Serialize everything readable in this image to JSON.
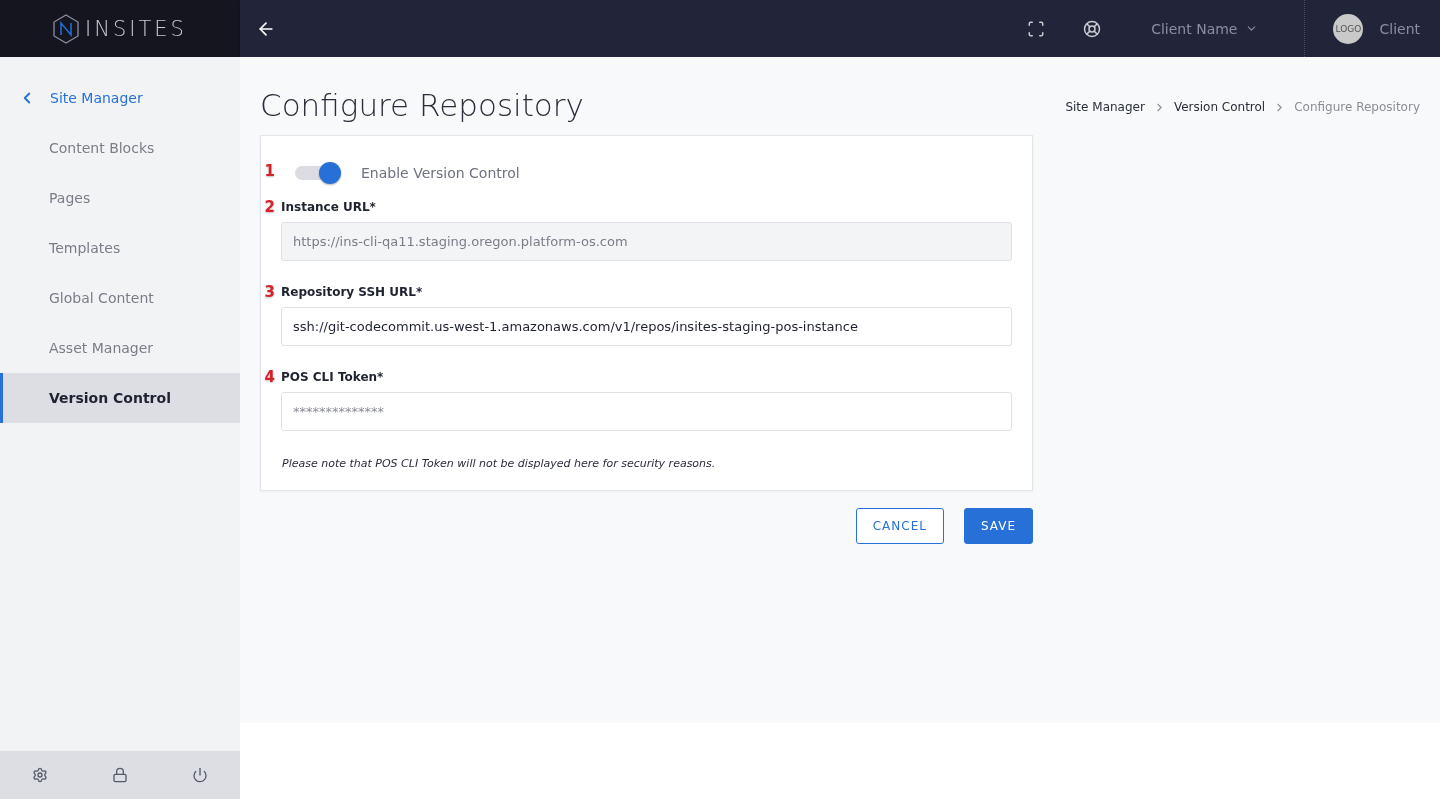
{
  "topbar": {
    "logo_text": "INSITES",
    "client_menu": "Client Name",
    "avatar_text": "LOGO",
    "account": "Client"
  },
  "sidebar": {
    "back_label": "Site Manager",
    "items": [
      {
        "label": "Content Blocks",
        "selected": false
      },
      {
        "label": "Pages",
        "selected": false
      },
      {
        "label": "Templates",
        "selected": false
      },
      {
        "label": "Global Content",
        "selected": false
      },
      {
        "label": "Asset Manager",
        "selected": false
      },
      {
        "label": "Version Control",
        "selected": true
      }
    ]
  },
  "page": {
    "title": "Configure Repository",
    "breadcrumbs": [
      {
        "label": "Site Manager",
        "current": false
      },
      {
        "label": "Version Control",
        "current": false
      },
      {
        "label": "Configure Repository",
        "current": true
      }
    ]
  },
  "form": {
    "toggle": {
      "marker": "1",
      "label": "Enable Version Control",
      "on": true
    },
    "fields": [
      {
        "marker": "2",
        "label": "Instance URL*",
        "value": "https://ins-cli-qa11.staging.oregon.platform-os.com",
        "disabled": true
      },
      {
        "marker": "3",
        "label": "Repository SSH URL*",
        "value": "ssh://git-codecommit.us-west-1.amazonaws.com/v1/repos/insites-staging-pos-instance",
        "disabled": false
      },
      {
        "marker": "4",
        "label": "POS CLI Token*",
        "placeholder": "**************",
        "disabled": false
      }
    ],
    "note": "Please note that POS CLI Token will not be displayed here for security reasons."
  },
  "buttons": [
    {
      "label": "CANCEL",
      "kind": "secondary"
    },
    {
      "label": "SAVE",
      "kind": "primary"
    }
  ]
}
